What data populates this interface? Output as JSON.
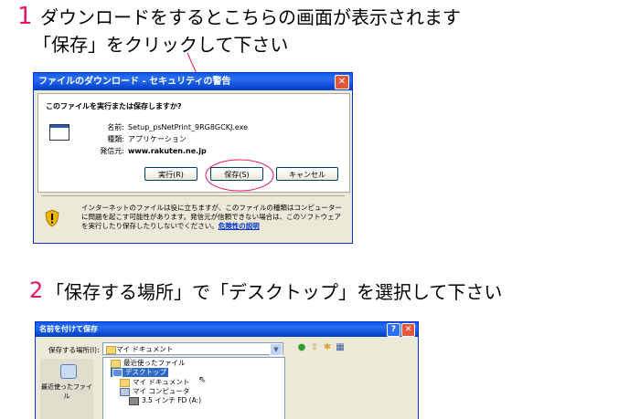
{
  "steps": [
    {
      "num": "1",
      "line1": "ダウンロードをするとこちらの画面が表示されます",
      "line2": "「保存」をクリックして下さい"
    },
    {
      "num": "2",
      "line1": "「保存する場所」で「デスクトップ」を選択して下さい"
    }
  ],
  "dialog1": {
    "title": "ファイルのダウンロード - セキュリティの警告",
    "close": "✕",
    "question": "このファイルを実行または保存しますか?",
    "name_label": "名前:",
    "name_value": "Setup_psNetPrint_9RG8GCKJ.exe",
    "type_label": "種類:",
    "type_value": "アプリケーション",
    "from_label": "発信元:",
    "from_value": "www.rakuten.ne.jp",
    "run_button": "実行(R)",
    "save_button": "保存(S)",
    "cancel_button": "キャンセル",
    "warning_text": "インターネットのファイルは役に立ちますが、このファイルの種類はコンピューターに問題を起こす可能性があります。発信元が信頼できない場合は、このソフトウェアを実行したり保存したりしないでください。",
    "warning_link": "危険性の説明"
  },
  "dialog2": {
    "title": "名前を付けて保存",
    "help": "?",
    "close": "✕",
    "location_label": "保存する場所(I):",
    "location_value": "マイ ドキュメント",
    "places_recent": "最近使ったファイル",
    "items": [
      "最近使ったファイル",
      "デスクトップ",
      "マイ ドキュメント",
      "マイ コンピュータ",
      "3.5 インチ FD (A:)"
    ]
  },
  "colors": {
    "accent_pink": "#e8146b",
    "title_blue": "#0a5ae6",
    "selection": "#316ac5"
  }
}
